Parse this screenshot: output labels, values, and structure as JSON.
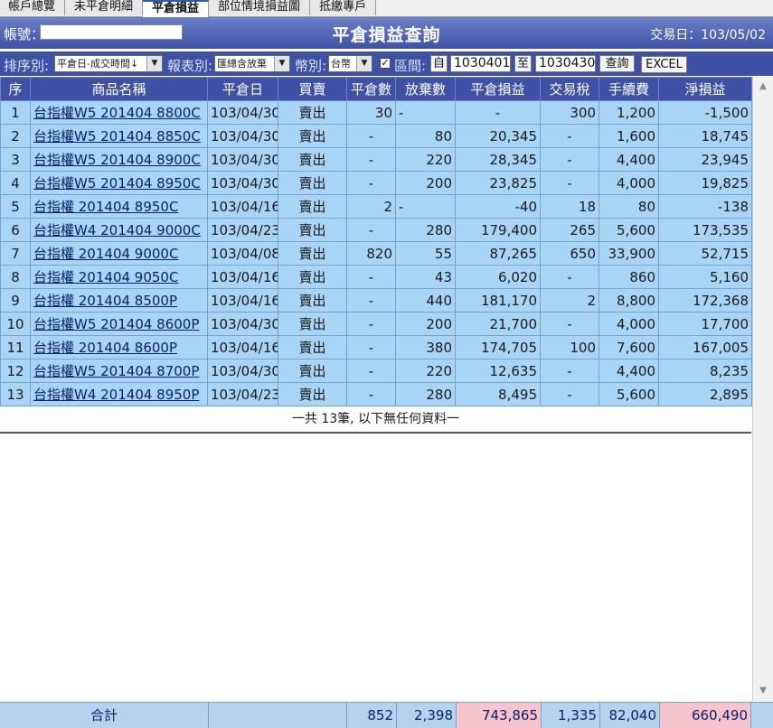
{
  "tabs": [
    "帳戶總覽",
    "未平倉明細",
    "平倉損益",
    "部位情境損益圖",
    "抵繳專戶"
  ],
  "active_tab": 2,
  "header": {
    "account_label": "帳號：",
    "title": "平倉損益查詢",
    "trade_date": "交易日：103/05/02"
  },
  "filter": {
    "sort_label": "排序別:",
    "sort_value": "平倉日-成交時間↓",
    "report_label": "報表別:",
    "report_value": "匯總含放棄",
    "currency_label": "幣別:",
    "currency_value": "台幣",
    "range_label": "區間:",
    "from_label": "自",
    "from_value": "1030401",
    "to_label": "至",
    "to_value": "1030430",
    "query_button": "查詢",
    "excel_button": "EXCEL"
  },
  "columns": [
    "序",
    "商品名稱",
    "平倉日",
    "買賣",
    "平倉數",
    "放棄數",
    "平倉損益",
    "交易稅",
    "手續費",
    "淨損益"
  ],
  "rows": [
    [
      "1",
      "台指權W5 201404 8800C",
      "103/04/30",
      "賣出",
      "30",
      "-",
      "-",
      "300",
      "1,200",
      "-1,500"
    ],
    [
      "2",
      "台指權W5 201404 8850C",
      "103/04/30",
      "賣出",
      "-",
      "80",
      "20,345",
      "-",
      "1,600",
      "18,745"
    ],
    [
      "3",
      "台指權W5 201404 8900C",
      "103/04/30",
      "賣出",
      "-",
      "220",
      "28,345",
      "-",
      "4,400",
      "23,945"
    ],
    [
      "4",
      "台指權W5 201404 8950C",
      "103/04/30",
      "賣出",
      "-",
      "200",
      "23,825",
      "-",
      "4,000",
      "19,825"
    ],
    [
      "5",
      "台指權 201404 8950C",
      "103/04/16",
      "賣出",
      "2",
      "-",
      "-40",
      "18",
      "80",
      "-138"
    ],
    [
      "6",
      "台指權W4 201404 9000C",
      "103/04/23",
      "賣出",
      "-",
      "280",
      "179,400",
      "265",
      "5,600",
      "173,535"
    ],
    [
      "7",
      "台指權 201404 9000C",
      "103/04/08",
      "賣出",
      "820",
      "55",
      "87,265",
      "650",
      "33,900",
      "52,715"
    ],
    [
      "8",
      "台指權 201404 9050C",
      "103/04/16",
      "賣出",
      "-",
      "43",
      "6,020",
      "-",
      "860",
      "5,160"
    ],
    [
      "9",
      "台指權 201404 8500P",
      "103/04/16",
      "賣出",
      "-",
      "440",
      "181,170",
      "2",
      "8,800",
      "172,368"
    ],
    [
      "10",
      "台指權W5 201404 8600P",
      "103/04/30",
      "賣出",
      "-",
      "200",
      "21,700",
      "-",
      "4,000",
      "17,700"
    ],
    [
      "11",
      "台指權 201404 8600P",
      "103/04/16",
      "賣出",
      "-",
      "380",
      "174,705",
      "100",
      "7,600",
      "167,005"
    ],
    [
      "12",
      "台指權W5 201404 8700P",
      "103/04/30",
      "賣出",
      "-",
      "220",
      "12,635",
      "-",
      "4,400",
      "8,235"
    ],
    [
      "13",
      "台指權W4 201404 8950P",
      "103/04/23",
      "賣出",
      "-",
      "280",
      "8,495",
      "-",
      "5,600",
      "2,895"
    ]
  ],
  "end_note": "一共 13筆, 以下無任何資料一",
  "totals": {
    "label": "合計",
    "close_qty": "852",
    "abandon_qty": "2,398",
    "pnl": "743,865",
    "tax": "1,335",
    "fee": "82,040",
    "net": "660,490"
  },
  "colors": {
    "header_blue": "#3f51a6",
    "row_blue": "#a8d4f5",
    "total_pink": "#f6c4cc"
  }
}
